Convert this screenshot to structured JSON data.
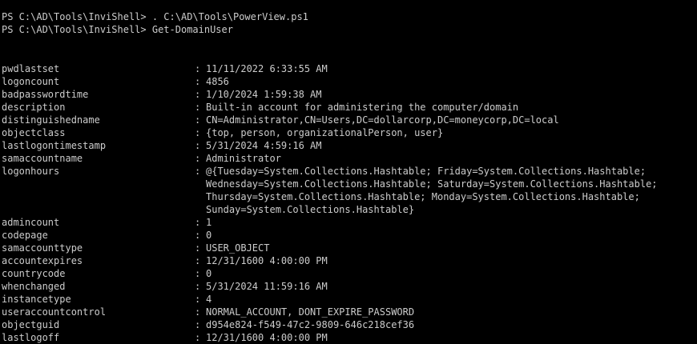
{
  "theme": {
    "background": "#000000",
    "foreground": "#cccccc"
  },
  "commands": [
    "PS C:\\AD\\Tools\\InviShell> . C:\\AD\\Tools\\PowerView.ps1",
    "PS C:\\AD\\Tools\\InviShell> Get-DomainUser"
  ],
  "separator": ":",
  "properties": [
    {
      "name": "pwdlastset",
      "value": "11/11/2022 6:33:55 AM"
    },
    {
      "name": "logoncount",
      "value": "4856"
    },
    {
      "name": "badpasswordtime",
      "value": "1/10/2024 1:59:38 AM"
    },
    {
      "name": "description",
      "value": "Built-in account for administering the computer/domain"
    },
    {
      "name": "distinguishedname",
      "value": "CN=Administrator,CN=Users,DC=dollarcorp,DC=moneycorp,DC=local"
    },
    {
      "name": "objectclass",
      "value": "{top, person, organizationalPerson, user}"
    },
    {
      "name": "lastlogontimestamp",
      "value": "5/31/2024 4:59:16 AM"
    },
    {
      "name": "samaccountname",
      "value": "Administrator"
    },
    {
      "name": "logonhours",
      "value": "@{Tuesday=System.Collections.Hashtable; Friday=System.Collections.Hashtable;"
    },
    {
      "name": "admincount",
      "value": "1"
    },
    {
      "name": "codepage",
      "value": "0"
    },
    {
      "name": "samaccounttype",
      "value": "USER_OBJECT"
    },
    {
      "name": "accountexpires",
      "value": "12/31/1600 4:00:00 PM"
    },
    {
      "name": "countrycode",
      "value": "0"
    },
    {
      "name": "whenchanged",
      "value": "5/31/2024 11:59:16 AM"
    },
    {
      "name": "instancetype",
      "value": "4"
    },
    {
      "name": "useraccountcontrol",
      "value": "NORMAL_ACCOUNT, DONT_EXPIRE_PASSWORD"
    },
    {
      "name": "objectguid",
      "value": "d954e824-f549-47c2-9809-646c218cef36"
    },
    {
      "name": "lastlogoff",
      "value": "12/31/1600 4:00:00 PM"
    }
  ],
  "logonhours_continuation": [
    "Wednesday=System.Collections.Hashtable; Saturday=System.Collections.Hashtable;",
    "Thursday=System.Collections.Hashtable; Monday=System.Collections.Hashtable;",
    "Sunday=System.Collections.Hashtable}"
  ]
}
